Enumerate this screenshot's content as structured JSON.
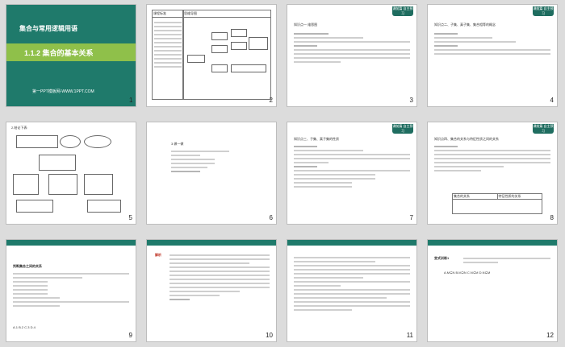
{
  "slides": {
    "s1": {
      "num": "1",
      "subtitle": "集合与常用逻辑用语",
      "title": "1.1.2  集合的基本关系",
      "source": "第一PPT模板网-WWW.1PPT.COM"
    },
    "s2": {
      "num": "2",
      "th_left": "课程标准",
      "th_right": "思维导图"
    },
    "s3": {
      "num": "3",
      "tag": "课前篇 自主预习",
      "heading": "知识点一  维恩图"
    },
    "s4": {
      "num": "4",
      "tag": "课前篇 自主预习",
      "heading": "知识点二、子集、真子集、集合相等的概念"
    },
    "s5": {
      "num": "5",
      "label": "2.结论下表:"
    },
    "s6": {
      "num": "6",
      "tag": "课前篇 自主预习",
      "heading": "3.做一做"
    },
    "s7": {
      "num": "7",
      "tag": "课前篇 自主预习",
      "heading": "知识点三、子集、真子集的性质"
    },
    "s8": {
      "num": "8",
      "tag": "课前篇 自主预习",
      "heading": "知识点四、集合的关系与特征性质之间的关系",
      "th_left": "集合的关系",
      "th_right": "特征性质的关系"
    },
    "s9": {
      "num": "9",
      "heading": "判断集合之间的关系",
      "options": "A.1  B.2  C.3  D.4"
    },
    "s10": {
      "num": "10",
      "label": "解析"
    },
    "s11": {
      "num": "11"
    },
    "s12": {
      "num": "12",
      "label": "变式训练1",
      "options": "A.M⊊N  B.M⊇N  C.N⊆M  D.N⊊M"
    }
  },
  "colors": {
    "accent": "#1f6d60",
    "bar": "#1f7a6b",
    "background": "#dcdcdc"
  }
}
